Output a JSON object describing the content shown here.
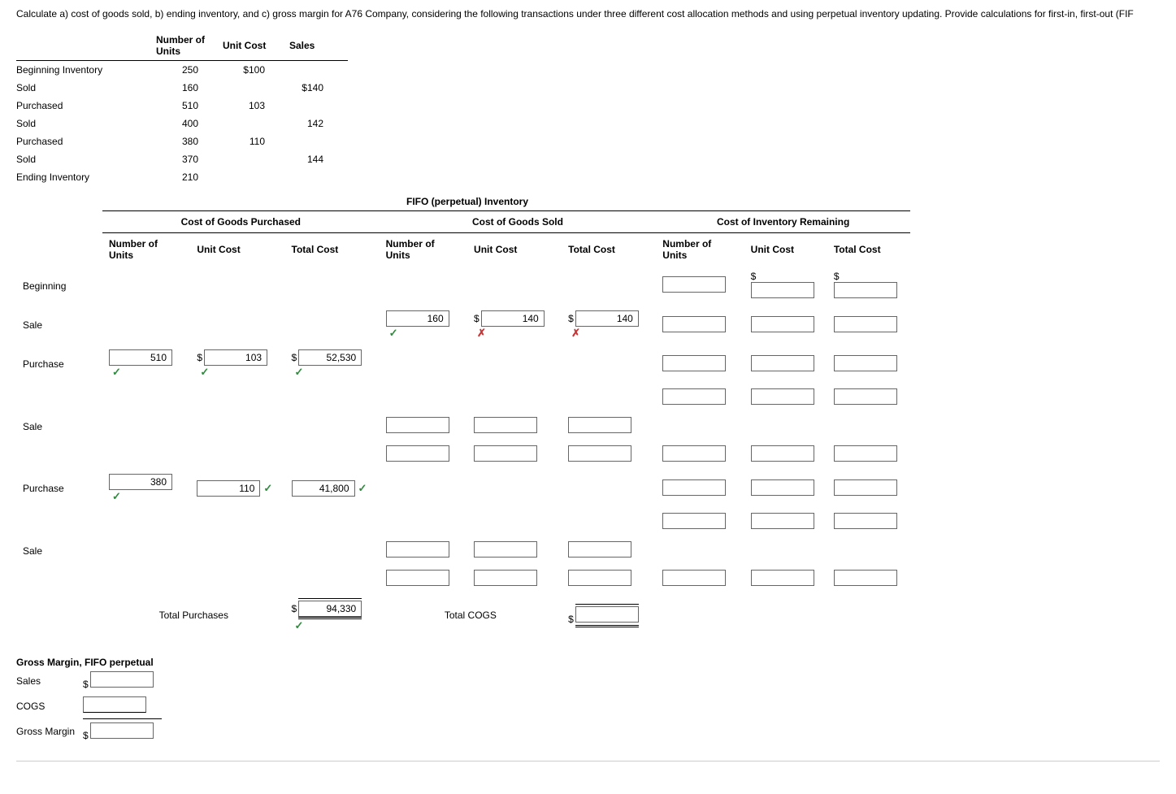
{
  "instruction": "Calculate a) cost of goods sold, b) ending inventory, and c) gross margin for A76 Company, considering the following transactions under three different cost allocation methods and using perpetual inventory updating. Provide calculations for first-in, first-out (FIF",
  "t1": {
    "h_units": "Number of Units",
    "h_cost": "Unit Cost",
    "h_sales": "Sales",
    "rows": [
      {
        "label": "Beginning Inventory",
        "units": "250",
        "cost": "$100",
        "sales": ""
      },
      {
        "label": "Sold",
        "units": "160",
        "cost": "",
        "sales": "$140"
      },
      {
        "label": "Purchased",
        "units": "510",
        "cost": "103",
        "sales": ""
      },
      {
        "label": "Sold",
        "units": "400",
        "cost": "",
        "sales": "142"
      },
      {
        "label": "Purchased",
        "units": "380",
        "cost": "110",
        "sales": ""
      },
      {
        "label": "Sold",
        "units": "370",
        "cost": "",
        "sales": "144"
      },
      {
        "label": "Ending Inventory",
        "units": "210",
        "cost": "",
        "sales": ""
      }
    ]
  },
  "fifo_title": "FIFO (perpetual) Inventory",
  "groups": {
    "purchased": "Cost of Goods Purchased",
    "sold": "Cost of Goods Sold",
    "remain": "Cost of Inventory Remaining"
  },
  "cols": {
    "units": "Number of Units",
    "ucost": "Unit Cost",
    "tcost": "Total Cost"
  },
  "rows": {
    "beginning": "Beginning",
    "sale": "Sale",
    "purchase": "Purchase",
    "total_purchases": "Total Purchases",
    "total_cogs": "Total COGS"
  },
  "vals": {
    "sale1_units": "160",
    "sale1_ucost": "140",
    "sale1_tcost": "140",
    "pur1_units": "510",
    "pur1_ucost": "103",
    "pur1_tcost": "52,530",
    "pur2_units": "380",
    "pur2_ucost": "110",
    "pur2_tcost": "41,800",
    "total_purch": "94,330"
  },
  "gm": {
    "title": "Gross Margin, FIFO perpetual",
    "sales": "Sales",
    "cogs": "COGS",
    "margin": "Gross Margin"
  },
  "dollar": "$"
}
